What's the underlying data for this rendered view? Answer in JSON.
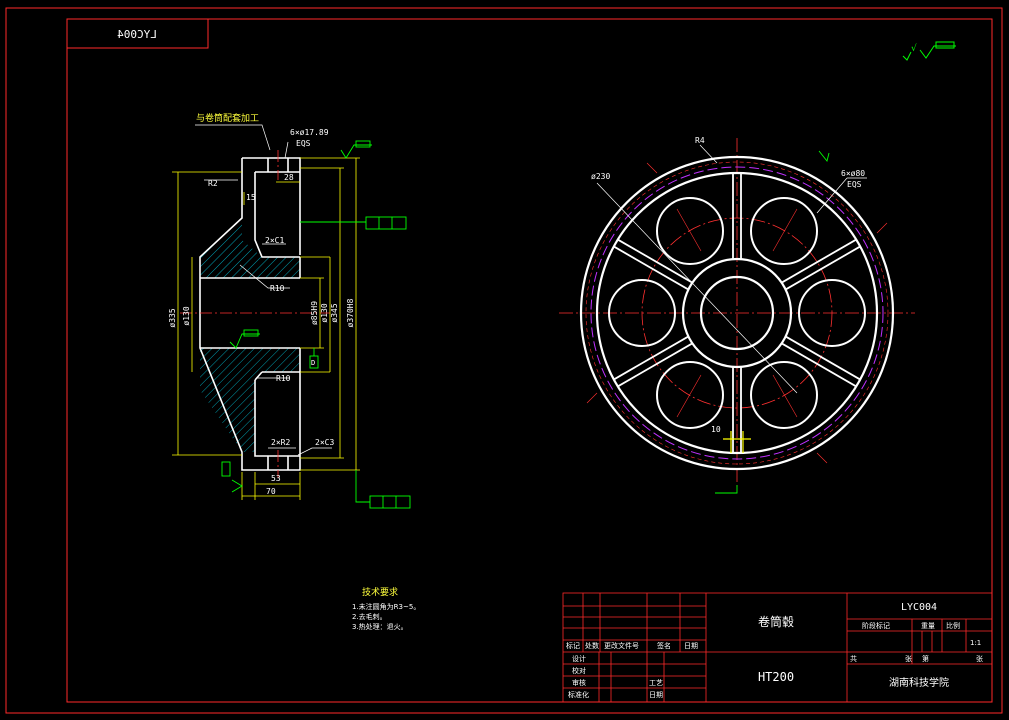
{
  "drawing_code_mirrored": "LYC004",
  "drawing_code": "LYC004",
  "part_name": "卷筒毂",
  "material": "HT200",
  "school": "湖南科技学院",
  "scale": "1:1",
  "top_right_roughness": "√",
  "section_view": {
    "note_machining": "与卷筒配套加工",
    "hole_note": "6×ø17.89",
    "hole_note2": "EQS",
    "dim_r2_top": "R2",
    "dim_15": "15",
    "dim_28": "28",
    "dim_2c1": "2×C1",
    "dim_r10_a": "R10",
    "dim_r10_b": "R10",
    "dim_2xr2": "2×R2",
    "dim_2c3": "2×C3",
    "dim_53": "53",
    "dim_70": "70",
    "dia_335": "ø335",
    "dia_130_left": "ø130",
    "dia_85": "ø85H9",
    "dia_130": "ø130",
    "dia_345": "ø345",
    "dia_370": "ø370H8",
    "datum_d": "D"
  },
  "front_view": {
    "r4": "R4",
    "d230": "ø230",
    "holes": "6×ø80",
    "holes_eqs": "EQS",
    "dim_10": "10"
  },
  "tech_req": {
    "title": "技术要求",
    "items": [
      "1.未注圆角为R3~5。",
      "2.去毛刺。",
      "3.热处理：退火。"
    ]
  },
  "title_block": {
    "row_labels": [
      "标记",
      "处数",
      "更改文件号",
      "签名",
      "日期"
    ],
    "design": "设计",
    "drafting": "校对",
    "review": "审核",
    "process": "工艺",
    "standard": "标准化",
    "approve": "批准",
    "date": "日期",
    "stage_mark": "阶段标记",
    "weight": "重量",
    "scale_label": "比例",
    "sheet_total": "共",
    "sheet": "张",
    "sheet_no": "第"
  }
}
